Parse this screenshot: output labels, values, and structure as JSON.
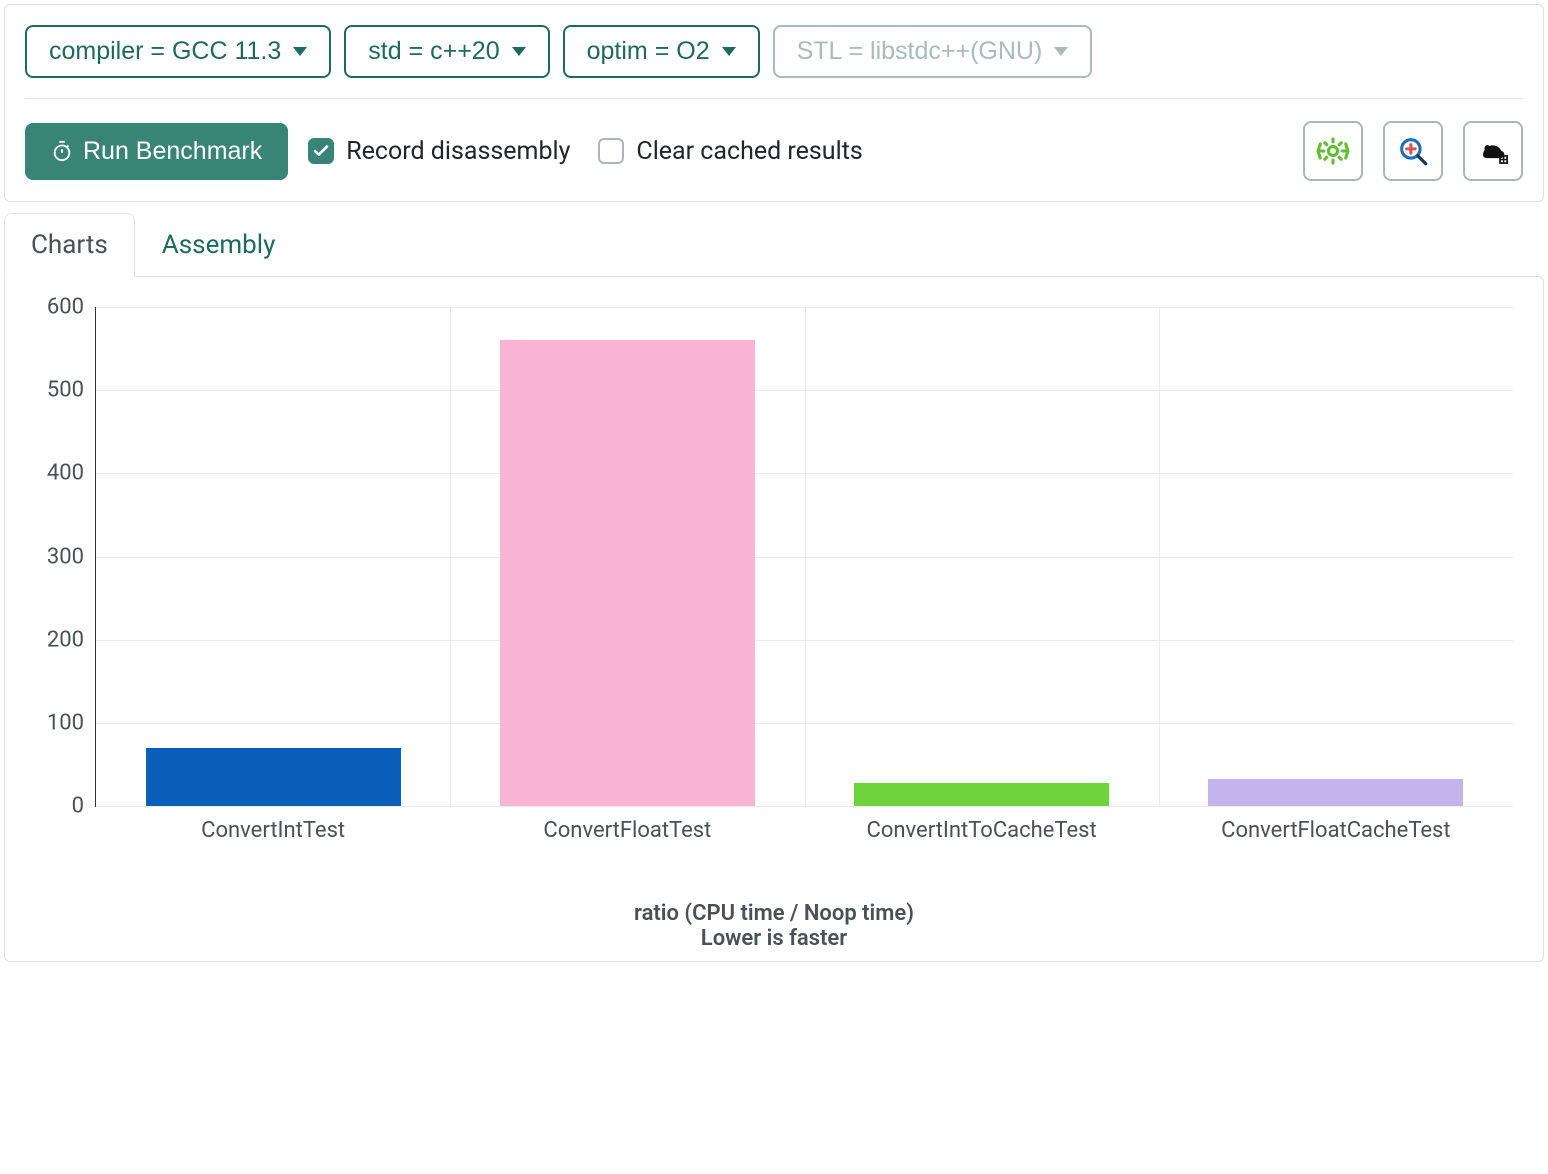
{
  "config": {
    "dropdowns": [
      {
        "label": "compiler = GCC 11.3",
        "disabled": false
      },
      {
        "label": "std = c++20",
        "disabled": false
      },
      {
        "label": "optim = O2",
        "disabled": false
      },
      {
        "label": "STL = libstdc++(GNU)",
        "disabled": true
      }
    ]
  },
  "actions": {
    "run_label": "Run Benchmark",
    "checkboxes": [
      {
        "label": "Record disassembly",
        "checked": true
      },
      {
        "label": "Clear cached results",
        "checked": false
      }
    ]
  },
  "tabs": [
    {
      "label": "Charts",
      "active": true
    },
    {
      "label": "Assembly",
      "active": false
    }
  ],
  "chart_data": {
    "type": "bar",
    "categories": [
      "ConvertIntTest",
      "ConvertFloatTest",
      "ConvertIntToCacheTest",
      "ConvertFloatCacheTest"
    ],
    "values": [
      70,
      560,
      28,
      32
    ],
    "colors": [
      "#0b5fba",
      "#f7b4d5",
      "#6fd33b",
      "#c3b4ee"
    ],
    "ylim": [
      0,
      600
    ],
    "yticks": [
      0,
      100,
      200,
      300,
      400,
      500,
      600
    ],
    "xlabel": "ratio (CPU time / Noop time)",
    "xsub": "Lower is faster"
  }
}
